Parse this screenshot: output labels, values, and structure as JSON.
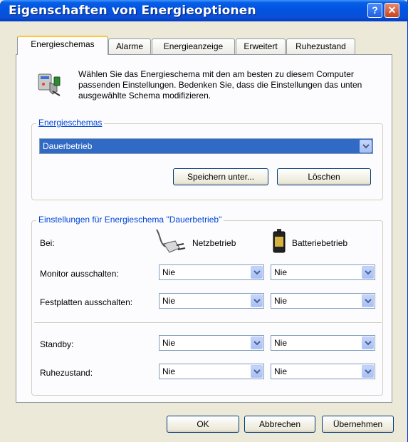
{
  "window": {
    "title": "Eigenschaften von Energieoptionen",
    "help_label": "?",
    "close_label": "✕"
  },
  "tabs": [
    {
      "label": "Energieschemas",
      "active": true
    },
    {
      "label": "Alarme",
      "active": false
    },
    {
      "label": "Energieanzeige",
      "active": false
    },
    {
      "label": "Erweitert",
      "active": false
    },
    {
      "label": "Ruhezustand",
      "active": false
    }
  ],
  "intro": {
    "icon": "power-options-icon",
    "text": "Wählen Sie das Energieschema mit den am besten zu diesem Computer passenden Einstellungen. Bedenken Sie, dass die Einstellungen das unten ausgewählte Schema modifizieren."
  },
  "schemes": {
    "legend": "Energieschemas",
    "selected": "Dauerbetrieb",
    "save_as_label": "Speichern unter...",
    "delete_label": "Löschen"
  },
  "settings": {
    "legend": "Einstellungen für Energieschema \"Dauerbetrieb\"",
    "at_label": "Bei:",
    "ac_label": "Netzbetrieb",
    "battery_label": "Batteriebetrieb",
    "ac_icon": "power-plug-icon",
    "battery_icon": "battery-icon",
    "rows": [
      {
        "label": "Monitor ausschalten:",
        "ac": "Nie",
        "battery": "Nie"
      },
      {
        "label": "Festplatten ausschalten:",
        "ac": "Nie",
        "battery": "Nie"
      },
      {
        "label": "Standby:",
        "ac": "Nie",
        "battery": "Nie"
      },
      {
        "label": "Ruhezustand:",
        "ac": "Nie",
        "battery": "Nie"
      }
    ]
  },
  "footer": {
    "ok_label": "OK",
    "cancel_label": "Abbrechen",
    "apply_label": "Übernehmen"
  }
}
